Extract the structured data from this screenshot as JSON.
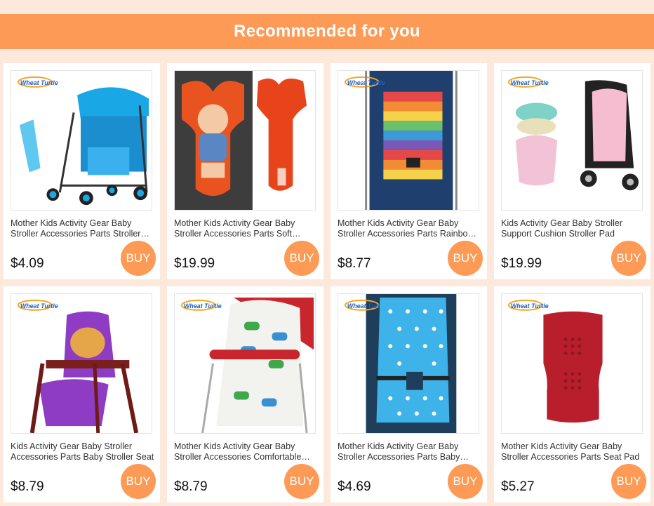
{
  "banner": {
    "title": "Recommended for you"
  },
  "buy_label": "BUY",
  "brand_logo_text": "Wheat Turtle",
  "colors": {
    "accent": "#fd9a56",
    "background": "#fde8dc"
  },
  "products": [
    {
      "title": "Mother Kids Activity Gear Baby Stroller Accessories Parts Stroller Cushion",
      "price": "$4.09",
      "image": "blue-stroller-with-cushion"
    },
    {
      "title": "Mother Kids Activity Gear Baby Stroller Accessories Parts Soft Cushion",
      "price": "$19.99",
      "image": "orange-bone-shaped-cushion"
    },
    {
      "title": "Mother Kids Activity Gear Baby Stroller Accessories Parts Rainbow Cushion",
      "price": "$8.77",
      "image": "rainbow-striped-cushion"
    },
    {
      "title": "Kids Activity Gear Baby Stroller Support Cushion Stroller Pad",
      "price": "$19.99",
      "image": "animal-stroller-cushion"
    },
    {
      "title": "Kids Activity Gear Baby Stroller Accessories Parts Baby Stroller Seat",
      "price": "$8.79",
      "image": "purple-high-chair-cushion"
    },
    {
      "title": "Mother Kids Activity Gear Baby Stroller Accessories Comfortable Cushion",
      "price": "$8.79",
      "image": "dinosaur-print-cushion"
    },
    {
      "title": "Mother Kids Activity Gear Baby Stroller Accessories Parts Baby Cushion",
      "price": "$4.69",
      "image": "blue-polka-dot-cushion"
    },
    {
      "title": "Mother Kids Activity Gear Baby Stroller Accessories Parts Seat Pad",
      "price": "$5.27",
      "image": "red-seat-pad"
    }
  ]
}
